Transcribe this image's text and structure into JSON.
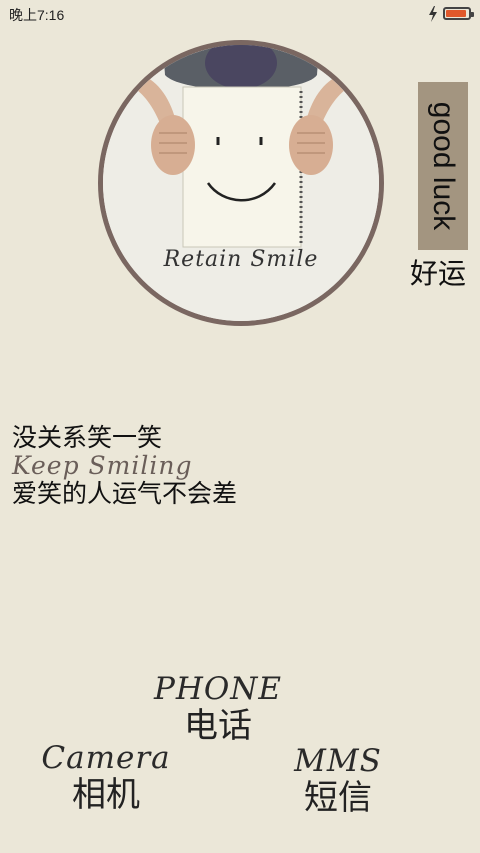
{
  "status_bar": {
    "time": "晚上7:16",
    "battery_level": 0.9,
    "charging": true,
    "battery_color": "#e0582b"
  },
  "photo": {
    "caption": "Retain  Smile",
    "ring_color": "#7a6761"
  },
  "luck_tag": {
    "english": "good luck",
    "chinese": "好运",
    "color": "#a39580"
  },
  "quote": {
    "line1": "没关系笑一笑",
    "line2": "Keep  Smiling",
    "line3": "爱笑的人运气不会差"
  },
  "shortcuts": {
    "phone": {
      "english": "PHONE",
      "chinese": "电话"
    },
    "camera": {
      "english": "Camera",
      "chinese": "相机"
    },
    "mms": {
      "english": "MMS",
      "chinese": "短信"
    }
  },
  "colors": {
    "background": "#ebe7d8"
  }
}
